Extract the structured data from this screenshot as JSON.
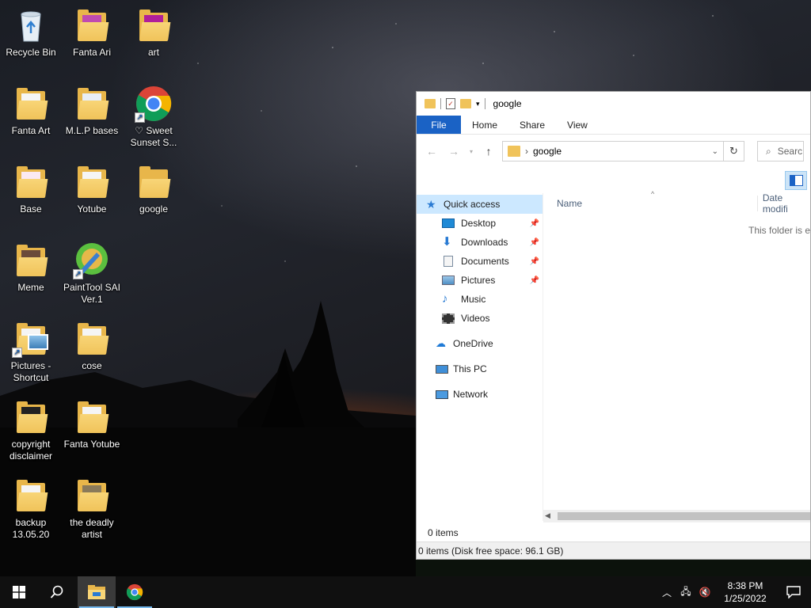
{
  "desktop": {
    "icons": [
      {
        "label": "Recycle Bin",
        "icon": "recycle-bin-icon"
      },
      {
        "label": "Fanta Ari",
        "icon": "folder-icon"
      },
      {
        "label": "art",
        "icon": "folder-icon"
      },
      {
        "label": "Fanta Art",
        "icon": "folder-icon"
      },
      {
        "label": "M.L.P bases",
        "icon": "folder-icon"
      },
      {
        "label": "♡ Sweet Sunset S...",
        "icon": "chrome-icon"
      },
      {
        "label": "Base",
        "icon": "folder-icon"
      },
      {
        "label": "Yotube",
        "icon": "folder-icon"
      },
      {
        "label": "google",
        "icon": "folder-icon"
      },
      {
        "label": "Meme",
        "icon": "folder-icon"
      },
      {
        "label": "PaintTool SAI Ver.1",
        "icon": "painttool-sai-icon"
      },
      {
        "label": "Pictures - Shortcut",
        "icon": "pictures-shortcut-icon"
      },
      {
        "label": "cose",
        "icon": "folder-icon"
      },
      {
        "label": "copyright disclaimer",
        "icon": "document-icon"
      },
      {
        "label": "Fanta Yotube",
        "icon": "folder-icon"
      },
      {
        "label": "backup 13.05.20",
        "icon": "folder-icon"
      },
      {
        "label": "the deadly artist",
        "icon": "folder-icon"
      }
    ]
  },
  "explorer": {
    "title": "google",
    "ribbon": {
      "file": "File",
      "home": "Home",
      "share": "Share",
      "view": "View"
    },
    "address": {
      "path": "google",
      "search_placeholder": "Searc"
    },
    "navpane": {
      "quick_access": "Quick access",
      "desktop": "Desktop",
      "downloads": "Downloads",
      "documents": "Documents",
      "pictures": "Pictures",
      "music": "Music",
      "videos": "Videos",
      "onedrive": "OneDrive",
      "this_pc": "This PC",
      "network": "Network"
    },
    "columns": {
      "name": "Name",
      "date": "Date modifi"
    },
    "empty_message": "This folder is en",
    "item_count": "0 items",
    "status": "0 items (Disk free space: 96.1 GB)"
  },
  "taskbar": {
    "time": "8:38 PM",
    "date": "1/25/2022"
  },
  "colors": {
    "accent": "#1a62c5",
    "selection": "#cce8ff",
    "folder": "#f0c35a",
    "taskbar": "#101010"
  }
}
